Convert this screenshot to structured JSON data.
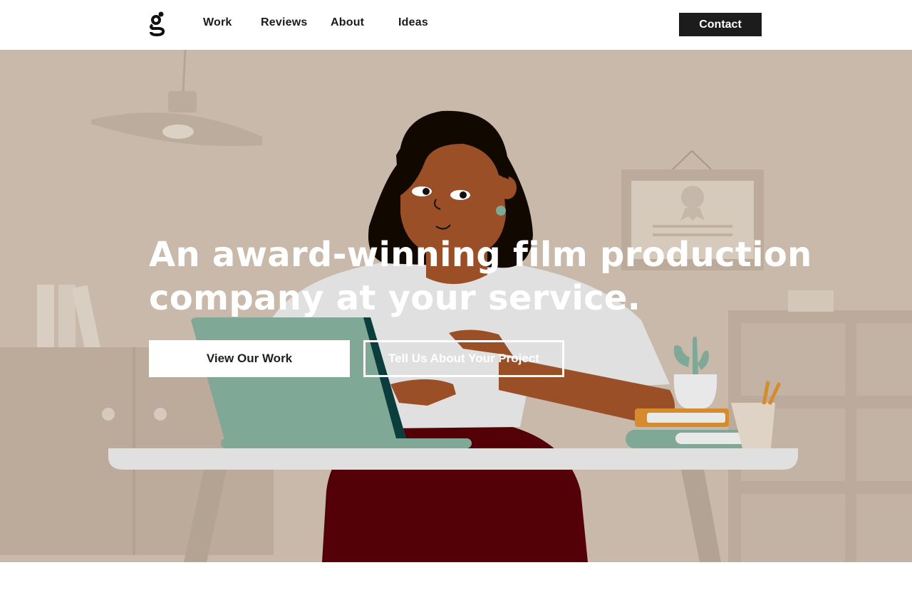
{
  "header": {
    "logo_icon": "g-logo-icon",
    "nav": [
      {
        "label": "Work"
      },
      {
        "label": "Reviews"
      },
      {
        "label": "About"
      },
      {
        "label": "Ideas"
      }
    ],
    "contact_label": "Contact"
  },
  "hero": {
    "headline_line1": "An award-winning film production",
    "headline_line2": "company at your service.",
    "primary_button": "View Our Work",
    "secondary_button": "Tell Us About Your Project"
  },
  "colors": {
    "hero_background": "#c8b9aa",
    "dark": "#1c1c1c",
    "button_text_light": "#ffffff"
  }
}
